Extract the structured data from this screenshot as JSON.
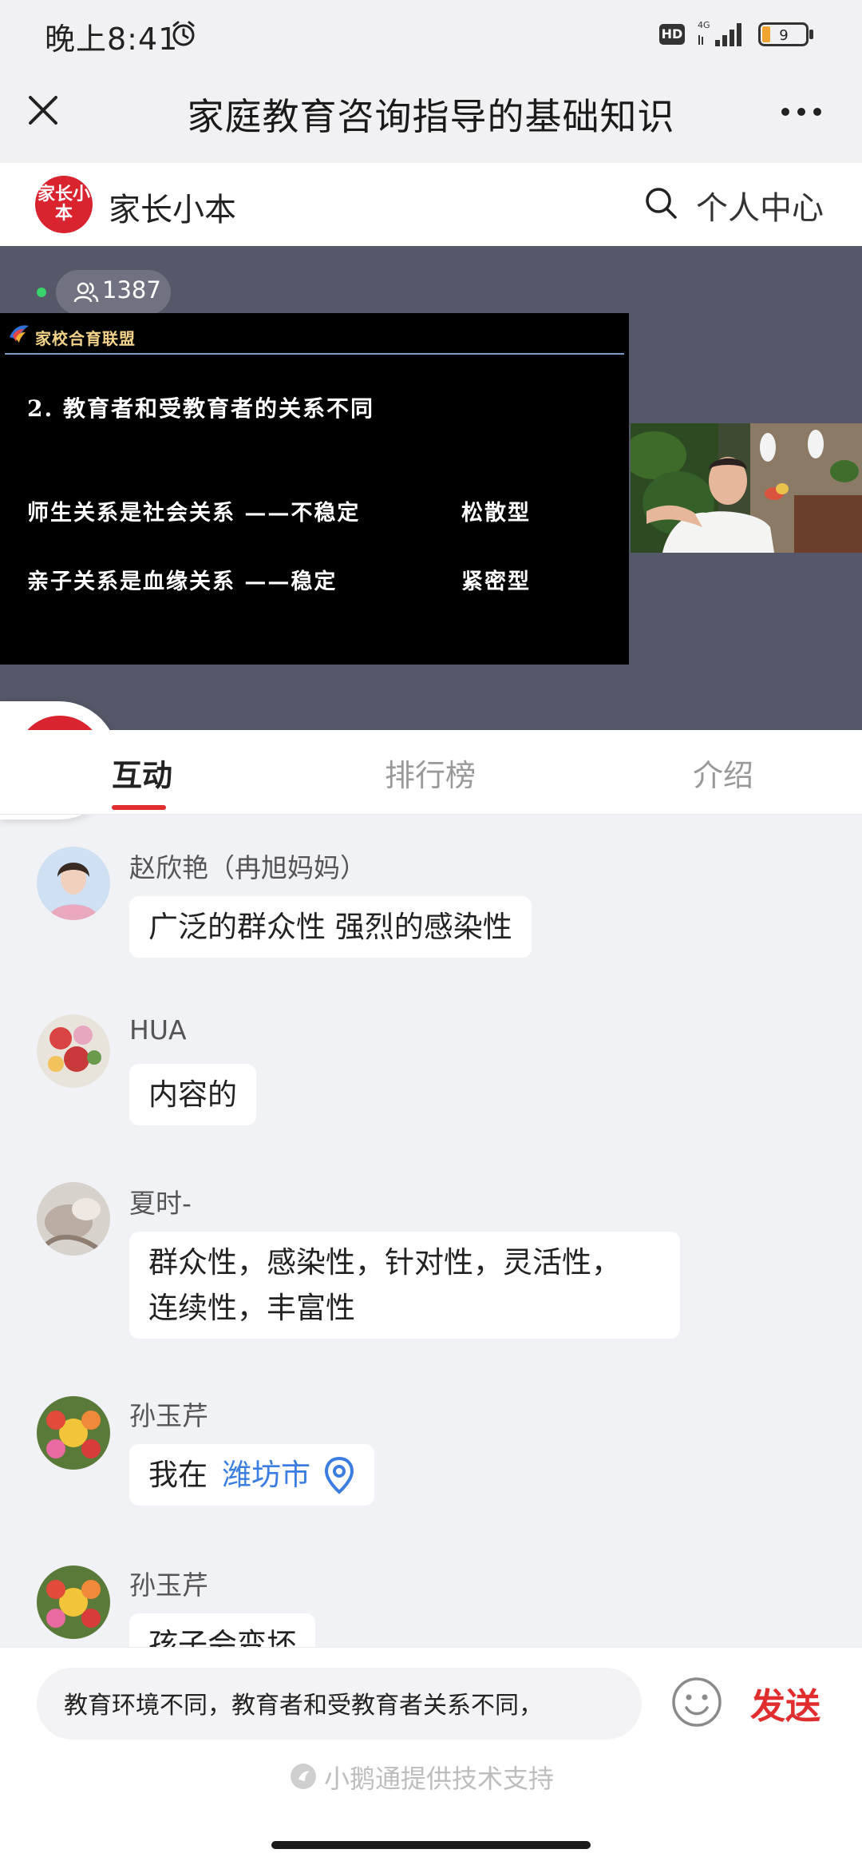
{
  "status_bar": {
    "time": "晚上8:41",
    "hd": "HD",
    "network": "4G",
    "battery": "9"
  },
  "title_bar": {
    "title": "家庭教育咨询指导的基础知识"
  },
  "brand": {
    "logo_text": "家长小本",
    "name": "家长小本",
    "personal_center": "个人中心"
  },
  "live": {
    "viewer_count": "1387",
    "slide": {
      "brand": "家校合育联盟",
      "heading": "2. 教育者和受教育者的关系不同",
      "rows": [
        {
          "left": "师生关系是社会关系 ——不稳定",
          "right": "松散型"
        },
        {
          "left": "亲子关系是血缘关系 ——稳定",
          "right": "紧密型"
        }
      ]
    }
  },
  "tabs": [
    {
      "label": "互动",
      "active": true
    },
    {
      "label": "排行榜",
      "active": false
    },
    {
      "label": "介绍",
      "active": false
    }
  ],
  "messages": [
    {
      "name": "赵欣艳（冉旭妈妈）",
      "text": "广泛的群众性 强烈的感染性"
    },
    {
      "name": "HUA",
      "text": "内容的"
    },
    {
      "name": "夏时-",
      "text_lines": [
        "群众性，感染性，针对性，灵活性，",
        "连续性，丰富性"
      ]
    },
    {
      "name": "孙玉芹",
      "location_prefix": "我在",
      "location_city": "潍坊市"
    },
    {
      "name": "孙玉芹",
      "text": "孩子会变坏"
    }
  ],
  "composer": {
    "input_value": "教育环境不同，教育者和受教育者关系不同，",
    "send_label": "发送"
  },
  "footer": {
    "support_text": "小鹅通提供技术支持"
  },
  "colors": {
    "accent": "#e02e2e",
    "brand_red": "#d9232e",
    "link_blue": "#3b7de0",
    "video_bg": "#555869"
  }
}
